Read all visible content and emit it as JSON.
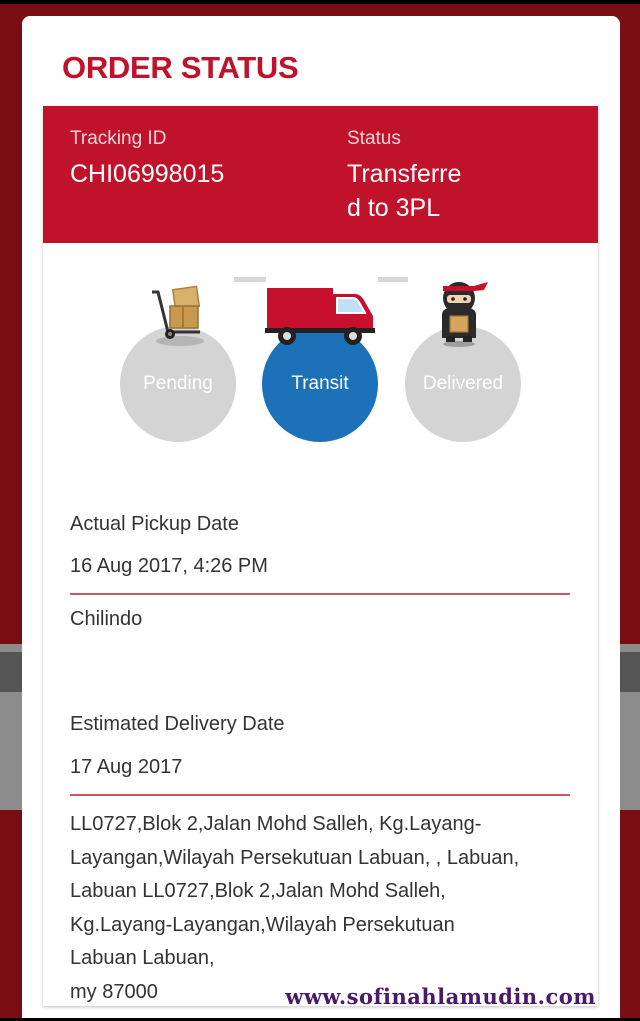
{
  "page_title": "ORDER STATUS",
  "tracking": {
    "label": "Tracking ID",
    "value": "CHI06998015"
  },
  "status": {
    "label": "Status",
    "value_line1": "Transferre",
    "value_line2": "d to 3PL"
  },
  "progress": {
    "steps": [
      {
        "label": "Pending",
        "icon": "hand-truck-boxes-icon",
        "active": false
      },
      {
        "label": "Transit",
        "icon": "delivery-truck-icon",
        "active": true
      },
      {
        "label": "Delivered",
        "icon": "ninja-courier-icon",
        "active": false
      }
    ]
  },
  "pickup": {
    "label": "Actual Pickup Date",
    "date": "16 Aug 2017, 4:26 PM",
    "location": "Chilindo"
  },
  "delivery": {
    "label": "Estimated Delivery Date",
    "date": "17 Aug 2017",
    "address_lines": [
      "LL0727,Blok 2,Jalan Mohd Salleh, Kg.Layang-",
      "Layangan,Wilayah Persekutuan Labuan, , Labuan,",
      "Labuan LL0727,Blok 2,Jalan Mohd Salleh,",
      "Kg.Layang-Layangan,Wilayah Persekutuan",
      "Labuan Labuan,",
      "my 87000"
    ]
  },
  "watermark": "www.sofinahlamudin.com",
  "colors": {
    "brand_red": "#c1122b",
    "active_blue": "#1d71b8",
    "inactive_grey": "#d4d4d4"
  }
}
